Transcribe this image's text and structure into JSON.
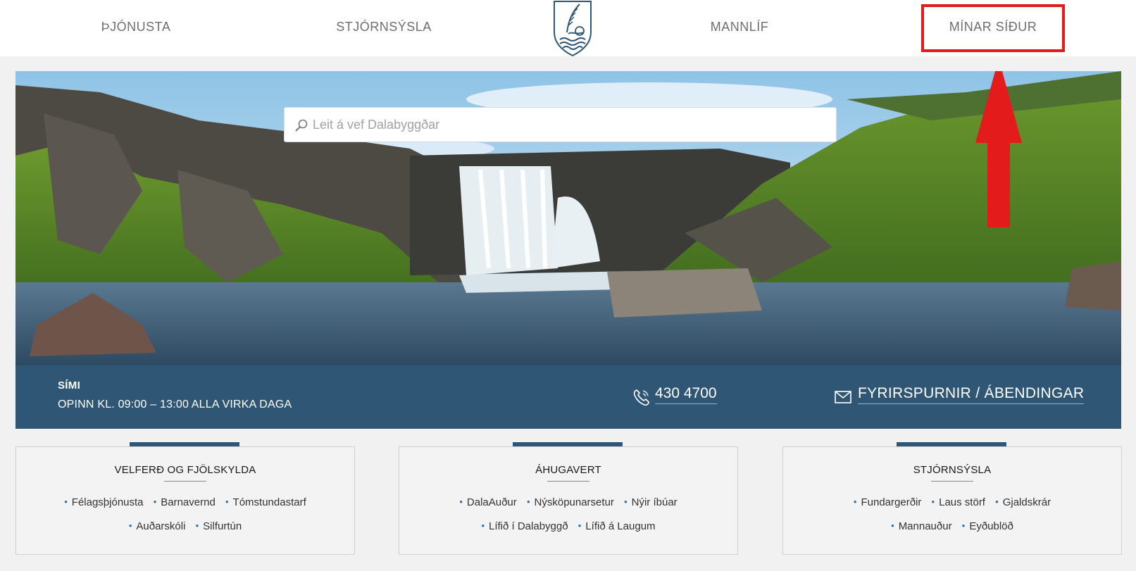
{
  "nav": {
    "items": [
      {
        "label": "ÞJÓNUSTA"
      },
      {
        "label": "STJÓRNSÝSLA"
      },
      {
        "label": "MANNLÍF"
      },
      {
        "label": "MÍNAR SÍÐUR"
      }
    ],
    "logo_icon": "coat-of-arms-icon"
  },
  "search": {
    "placeholder": "Leit á vef Dalabyggðar",
    "value": "",
    "icon": "search-icon"
  },
  "annotation": {
    "highlight_color": "#e41b1b",
    "arrow_icon": "up-arrow-icon"
  },
  "info": {
    "title": "SÍMI",
    "hours": "OPINN KL. 09:00 – 13:00 ALLA VIRKA DAGA",
    "phone": "430 4700",
    "phone_icon": "phone-icon",
    "contact": "FYRIRSPURNIR / ÁBENDINGAR",
    "contact_icon": "mail-icon",
    "bar_color": "#2f5775"
  },
  "cards": [
    {
      "title": "VELFERÐ OG FJÖLSKYLDA",
      "row1": [
        "Félagsþjónusta",
        "Barnavernd",
        "Tómstundastarf"
      ],
      "row2": [
        "Auðarskóli",
        "Silfurtún"
      ]
    },
    {
      "title": "ÁHUGAVERT",
      "row1": [
        "DalaAuður",
        "Nýsköpunarsetur",
        "Nýir íbúar"
      ],
      "row2": [
        "Lífið í Dalabyggð",
        "Lífið á Laugum"
      ]
    },
    {
      "title": "STJÓRNSÝSLA",
      "row1": [
        "Fundargerðir",
        "Laus störf",
        "Gjaldskrár"
      ],
      "row2": [
        "Mannauður",
        "Eyðublöð"
      ]
    }
  ]
}
